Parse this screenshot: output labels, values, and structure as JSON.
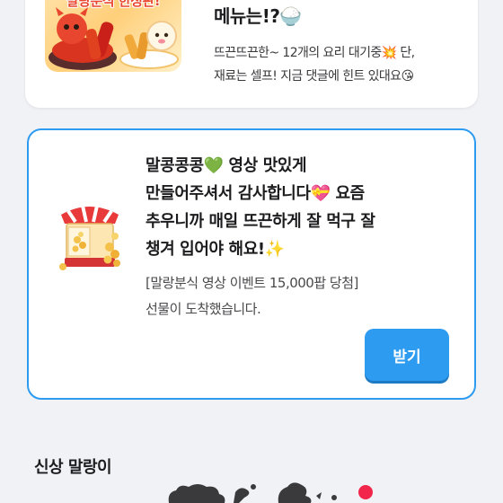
{
  "event_card": {
    "thumbnail_banner": "말랑분식 한정판!",
    "title": "메뉴는!?🍚",
    "description_line1": "뜨끈뜨끈한~ 12개의 요리 대기중💥 단,",
    "description_line2": "재료는 셀프! 지금 댓글에 힌트 있대요😘"
  },
  "gift_card": {
    "message_lines": [
      "말콩콩콩💚 영상 맛있게",
      "만들어주셔서 감사합니다💝 요즘",
      "추우니까 매일 뜨끈하게 잘 먹구 잘",
      "챙겨 입어야 해요!✨"
    ],
    "notice_line1": "[말랑분식 영상 이벤트 15,000팝 당첨]",
    "notice_line2": "선물이 도착했습니다.",
    "button_label": "받기",
    "accent_color": "#2d9bef"
  },
  "new_section": {
    "title": "신상 말랑이",
    "badge_color": "#f2264b"
  }
}
